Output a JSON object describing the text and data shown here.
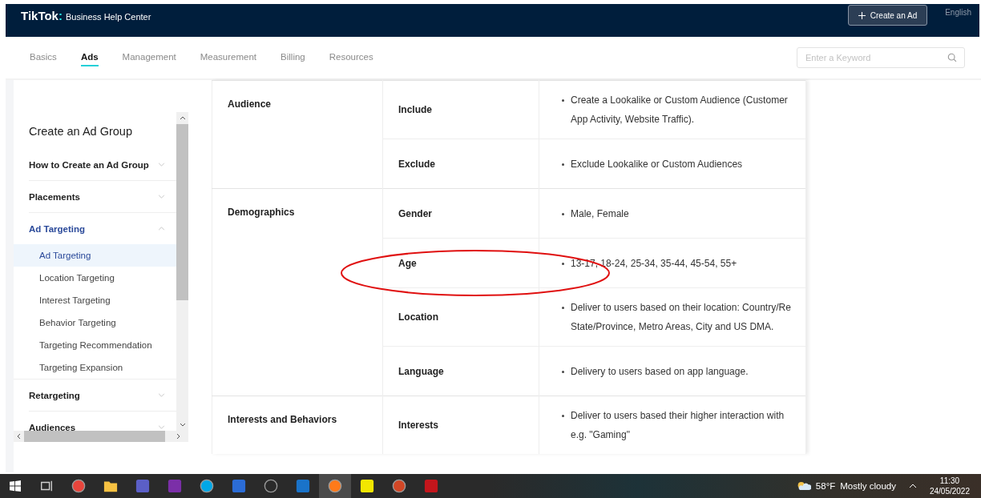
{
  "header": {
    "logo": "TikTok",
    "logo_mark": ":",
    "site": "Business Help Center",
    "create_button": "Create an Ad",
    "language": "English"
  },
  "tabs": [
    {
      "label": "Basics",
      "selected": false
    },
    {
      "label": "Ads",
      "selected": true
    },
    {
      "label": "Management",
      "selected": false
    },
    {
      "label": "Measurement",
      "selected": false
    },
    {
      "label": "Billing",
      "selected": false
    },
    {
      "label": "Resources",
      "selected": false
    }
  ],
  "search": {
    "placeholder": "Enter a Keyword"
  },
  "sidebar": {
    "title": "Create an Ad Group",
    "items": [
      {
        "label": "How to Create an Ad Group",
        "expanded": false
      },
      {
        "label": "Placements",
        "expanded": false
      },
      {
        "label": "Ad Targeting",
        "expanded": true,
        "children": [
          {
            "label": "Ad Targeting",
            "selected": true
          },
          {
            "label": "Location Targeting",
            "selected": false
          },
          {
            "label": "Interest Targeting",
            "selected": false
          },
          {
            "label": "Behavior Targeting",
            "selected": false
          },
          {
            "label": "Targeting Recommendation",
            "selected": false
          },
          {
            "label": "Targeting Expansion",
            "selected": false
          }
        ]
      },
      {
        "label": "Retargeting",
        "expanded": false
      },
      {
        "label": "Audiences",
        "expanded": false
      }
    ]
  },
  "table": {
    "groups": [
      {
        "category": "Audience",
        "rows": [
          {
            "option": "Include",
            "lines": [
              "Create a Lookalike or Custom Audience (Customer",
              "App Activity, Website Traffic)."
            ]
          },
          {
            "option": "Exclude",
            "lines": [
              "Exclude Lookalike or Custom Audiences"
            ]
          }
        ]
      },
      {
        "category": "Demographics",
        "rows": [
          {
            "option": "Gender",
            "lines": [
              "Male, Female"
            ]
          },
          {
            "option": "Age",
            "lines": [
              "13-17, 18-24, 25-34, 35-44, 45-54, 55+"
            ]
          },
          {
            "option": "Location",
            "lines": [
              "Deliver to users based on their location: Country/Re",
              "State/Province, Metro Areas, City and US DMA."
            ]
          },
          {
            "option": "Language",
            "lines": [
              "Delivery to users based on app language."
            ]
          }
        ]
      },
      {
        "category": "Interests and Behaviors",
        "rows": [
          {
            "option": "Interests",
            "lines": [
              "Deliver to users based their higher interaction with",
              "e.g. \"Gaming\""
            ]
          }
        ]
      }
    ]
  },
  "taskbar": {
    "apps": [
      {
        "kind": "taskview",
        "color": "#cfcfcf",
        "active": false
      },
      {
        "kind": "circle",
        "color": "#e8453c",
        "active": false
      },
      {
        "kind": "folder",
        "color": "#f6c142",
        "active": false
      },
      {
        "kind": "square",
        "color": "#5b5fc7",
        "active": false
      },
      {
        "kind": "square",
        "color": "#7b2fa8",
        "active": false
      },
      {
        "kind": "circle",
        "color": "#00a8e8",
        "active": false
      },
      {
        "kind": "square",
        "color": "#2b6cd6",
        "active": false
      },
      {
        "kind": "circle",
        "color": "#2a2a2a",
        "active": false
      },
      {
        "kind": "square",
        "color": "#1a73c9",
        "active": false
      },
      {
        "kind": "circle",
        "color": "#ff7a1a",
        "active": true
      },
      {
        "kind": "square",
        "color": "#f2e600",
        "active": false
      },
      {
        "kind": "circle",
        "color": "#d24726",
        "active": false
      },
      {
        "kind": "square",
        "color": "#c4161c",
        "active": false
      }
    ],
    "temperature": "58°F",
    "weather": "Mostly cloudy",
    "time": "11:30",
    "date": "24/05/2022"
  }
}
